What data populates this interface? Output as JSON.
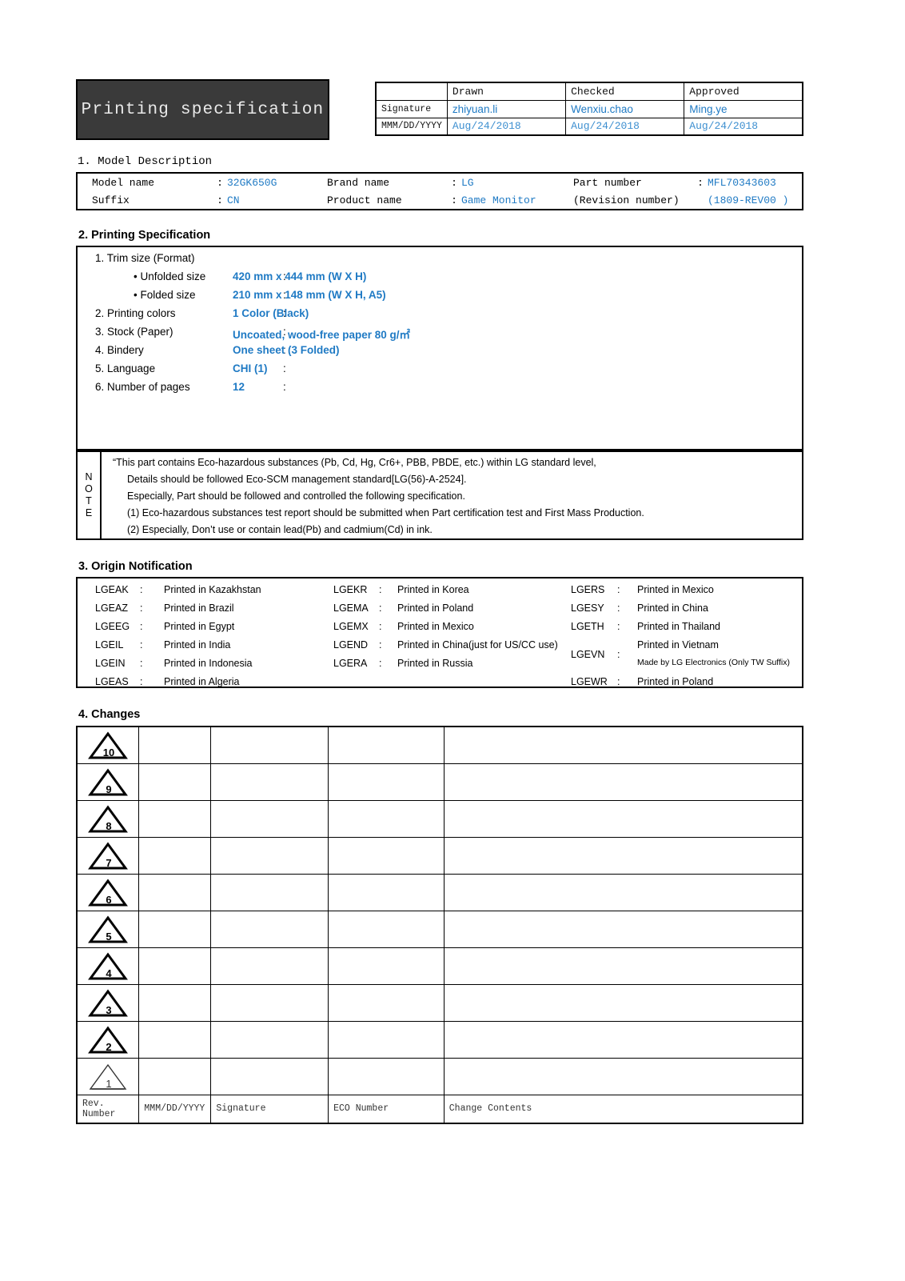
{
  "document": {
    "title": "Printing specification"
  },
  "approval": {
    "columns": [
      "Drawn",
      "Checked",
      "Approved"
    ],
    "row_labels": {
      "signature": "Signature",
      "date": "MMM/DD/YYYY"
    },
    "signatures": [
      "zhiyuan.li",
      "Wenxiu.chao",
      "Ming.ye"
    ],
    "dates": [
      "Aug/24/2018",
      "Aug/24/2018",
      "Aug/24/2018"
    ]
  },
  "section1": {
    "heading": "1. Model Description",
    "fields": [
      {
        "label": "Model name",
        "colon": ":",
        "value": "32GK650G",
        "label2": "Brand name",
        "colon2": ":",
        "value2": "LG",
        "label3": "Part number",
        "colon3": ":",
        "value3": "MFL70343603"
      },
      {
        "label": "Suffix",
        "colon": ":",
        "value": "CN",
        "label2": "Product name",
        "colon2": ":",
        "value2": "Game Monitor",
        "label3": "(Revision number)",
        "colon3": "",
        "value3": "(1809-REV00 )"
      }
    ]
  },
  "section2": {
    "heading": "2. Printing Specification",
    "trim_heading": "1. Trim size (Format)",
    "items": [
      {
        "label": "• Unfolded size",
        "colon": ":",
        "value": "420 mm x 444 mm (W X H)"
      },
      {
        "label": "• Folded size",
        "colon": ":",
        "value": "210 mm x 148 mm (W X H, A5)"
      },
      {
        "label": "2. Printing colors",
        "colon": ":",
        "value": "1 Color (Black)"
      },
      {
        "label": "3. Stock (Paper)",
        "colon": ":",
        "value": "Uncoated, wood-free paper 80 g/㎡"
      },
      {
        "label": "4. Bindery",
        "colon": ":",
        "value": "One sheet (3 Folded)"
      },
      {
        "label": "5. Language",
        "colon": ":",
        "value": "CHI (1)"
      },
      {
        "label": "6. Number of pages",
        "colon": ":",
        "value": "12"
      }
    ],
    "note": {
      "label_letters": [
        "N",
        "O",
        "T",
        "E"
      ],
      "lines": [
        "“This part contains Eco-hazardous substances (Pb, Cd, Hg, Cr6+, PBB, PBDE, etc.) within LG standard level,",
        "Details should be followed Eco-SCM management standard[LG(56)-A-2524].",
        "Especially, Part should be followed and controlled the following specification.",
        "(1) Eco-hazardous substances test report should be submitted when Part certification test and First Mass Production.",
        "(2) Especially, Don’t use or contain lead(Pb) and cadmium(Cd) in ink."
      ]
    }
  },
  "section3": {
    "heading": "3. Origin Notification",
    "col1": [
      {
        "code": "LGEAK",
        "colon": ":",
        "text": "Printed in Kazakhstan"
      },
      {
        "code": "LGEAZ",
        "colon": ":",
        "text": "Printed in Brazil"
      },
      {
        "code": "LGEEG",
        "colon": ":",
        "text": "Printed in Egypt"
      },
      {
        "code": "LGEIL",
        "colon": ":",
        "text": "Printed in India"
      },
      {
        "code": "LGEIN",
        "colon": ":",
        "text": "Printed in Indonesia"
      },
      {
        "code": "LGEAS",
        "colon": ":",
        "text": "Printed in Algeria"
      }
    ],
    "col2": [
      {
        "code": "LGEKR",
        "colon": ":",
        "text": "Printed in Korea"
      },
      {
        "code": "LGEMA",
        "colon": ":",
        "text": "Printed in Poland"
      },
      {
        "code": "LGEMX",
        "colon": ":",
        "text": "Printed in Mexico"
      },
      {
        "code": "LGEND",
        "colon": ":",
        "text": "Printed in China(just for US/CC use)"
      },
      {
        "code": "LGERA",
        "colon": ":",
        "text": "Printed in Russia"
      }
    ],
    "col3": [
      {
        "code": "LGERS",
        "colon": ":",
        "text": "Printed in Mexico"
      },
      {
        "code": "LGESY",
        "colon": ":",
        "text": "Printed in China"
      },
      {
        "code": "LGETH",
        "colon": ":",
        "text": "Printed in Thailand"
      },
      {
        "code": "LGEVN",
        "colon": ":",
        "text": "Printed in Vietnam",
        "text2": "Made by LG Electronics (Only TW Suffix)"
      },
      {
        "code": "LGEWR",
        "colon": ":",
        "text": "Printed in Poland"
      }
    ]
  },
  "section4": {
    "heading": "4. Changes",
    "rows": [
      {
        "rev": "10",
        "date": "",
        "signature": "",
        "eco": "",
        "contents": ""
      },
      {
        "rev": "9",
        "date": "",
        "signature": "",
        "eco": "",
        "contents": ""
      },
      {
        "rev": "8",
        "date": "",
        "signature": "",
        "eco": "",
        "contents": ""
      },
      {
        "rev": "7",
        "date": "",
        "signature": "",
        "eco": "",
        "contents": ""
      },
      {
        "rev": "6",
        "date": "",
        "signature": "",
        "eco": "",
        "contents": ""
      },
      {
        "rev": "5",
        "date": "",
        "signature": "",
        "eco": "",
        "contents": ""
      },
      {
        "rev": "4",
        "date": "",
        "signature": "",
        "eco": "",
        "contents": ""
      },
      {
        "rev": "3",
        "date": "",
        "signature": "",
        "eco": "",
        "contents": ""
      },
      {
        "rev": "2",
        "date": "",
        "signature": "",
        "eco": "",
        "contents": ""
      },
      {
        "rev": "1",
        "date": "",
        "signature": "",
        "eco": "",
        "contents": ""
      }
    ],
    "footer": [
      "Rev. Number",
      "MMM/DD/YYYY",
      "Signature",
      "ECO Number",
      "Change Contents"
    ]
  },
  "colors": {
    "accent_blue": "#1f7ac4",
    "title_block_bg": "#3a3a3a",
    "title_block_fg": "#e9e9e9"
  }
}
